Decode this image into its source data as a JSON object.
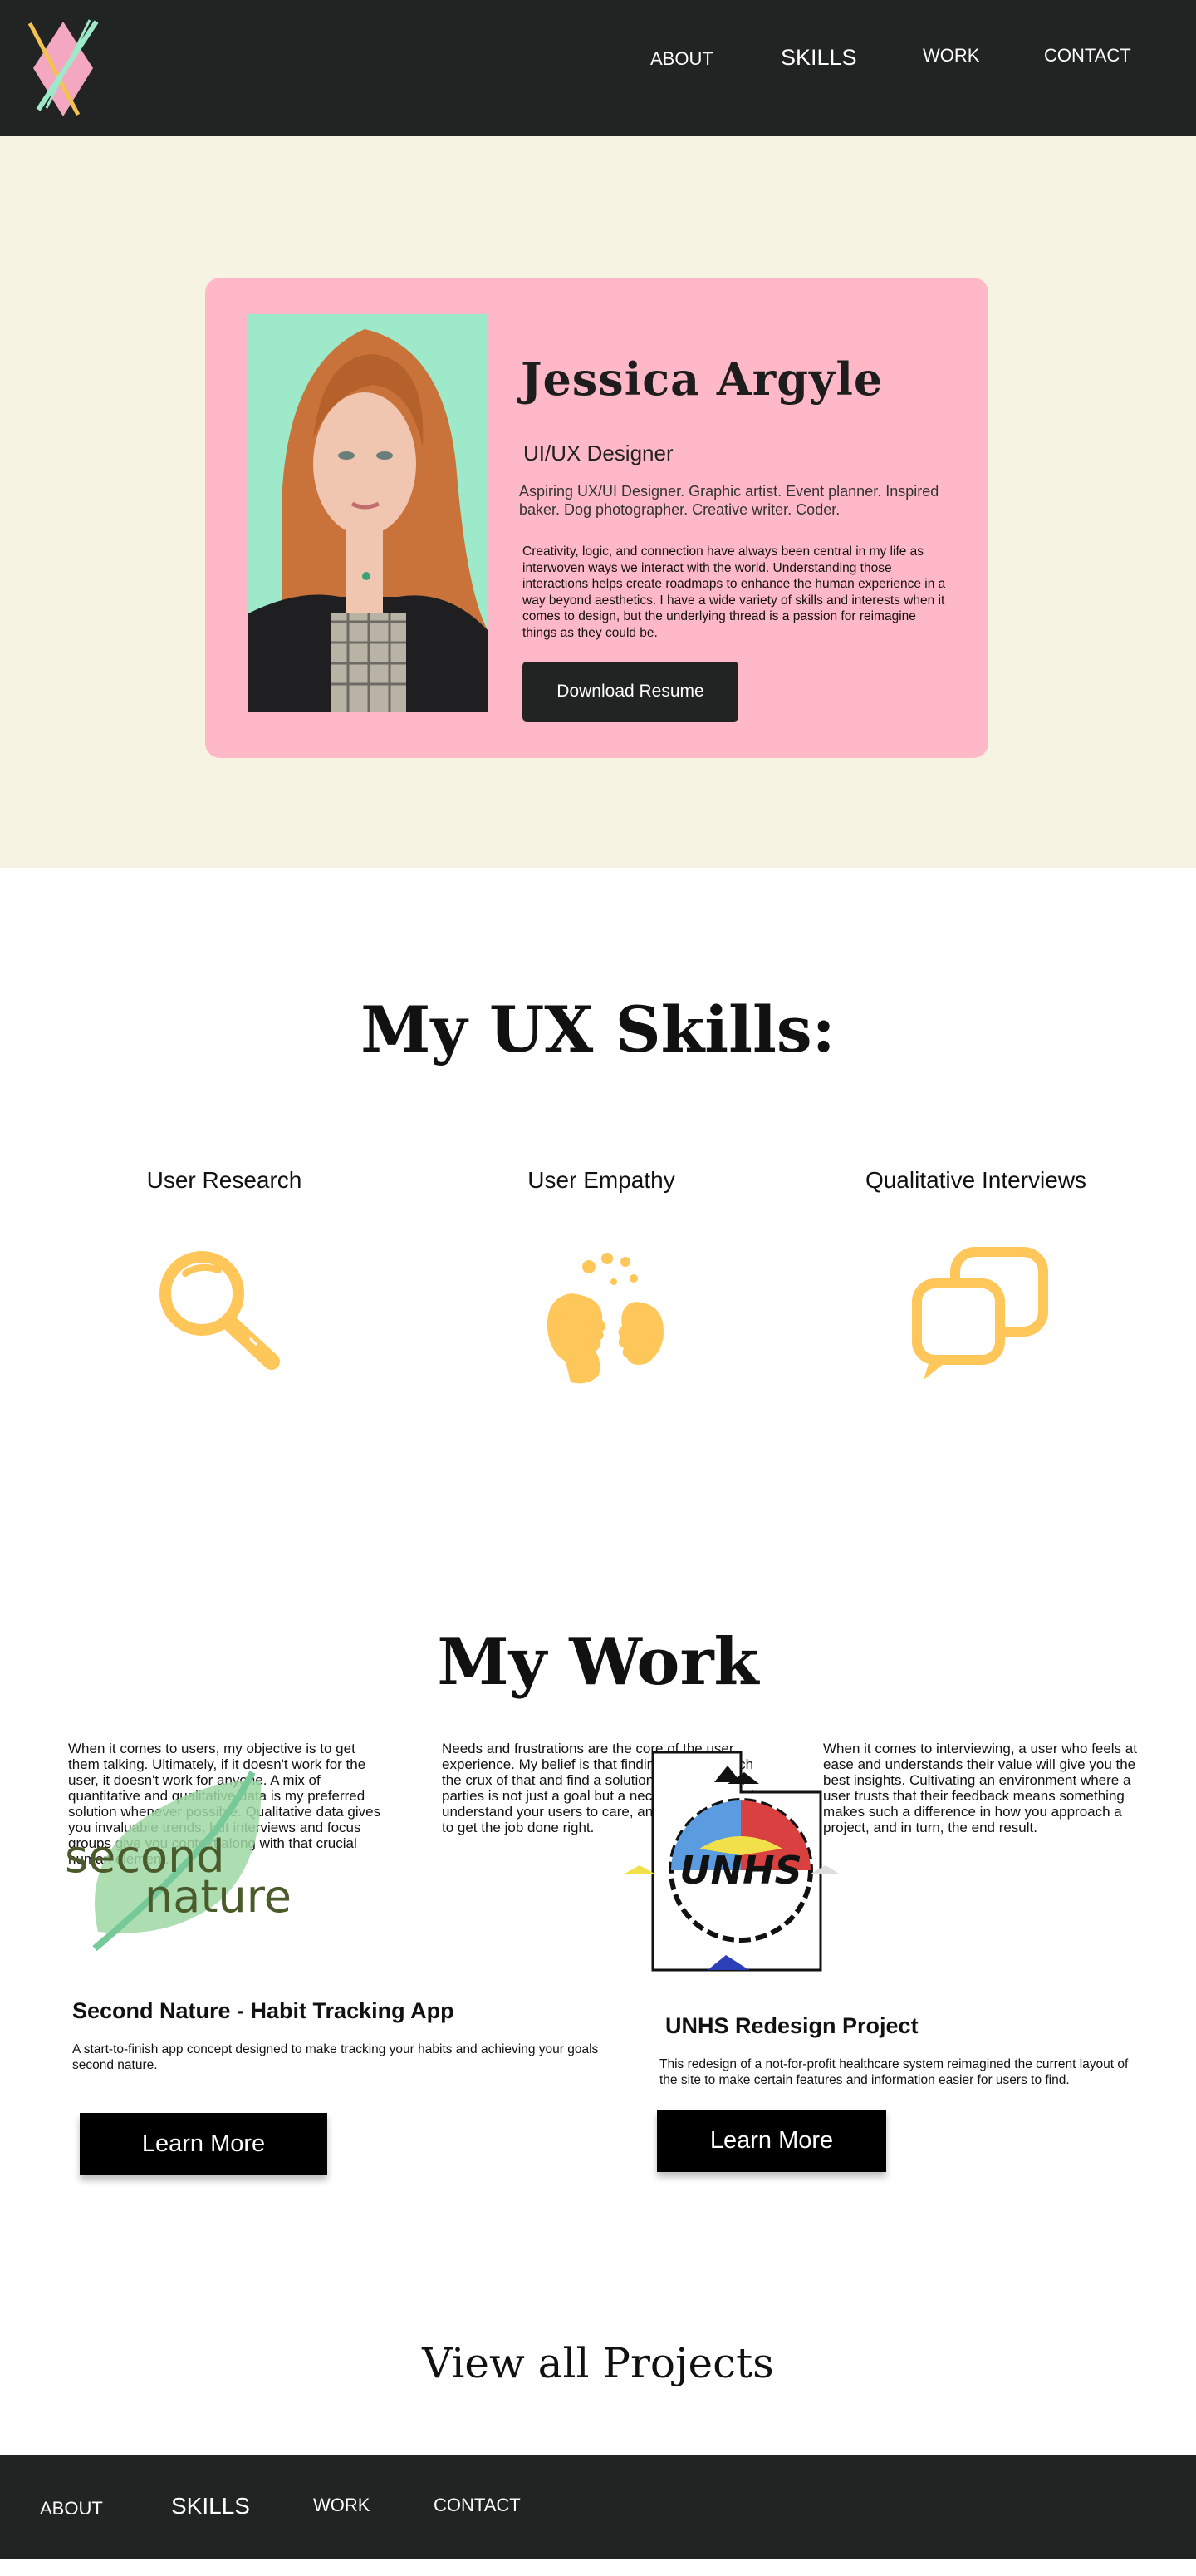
{
  "nav": {
    "about": "ABOUT",
    "skills": "SKILLS",
    "work": "WORK",
    "contact": "CONTACT"
  },
  "hero": {
    "name": "Jessica Argyle",
    "role": "UI/UX Designer",
    "tagline": "Aspiring UX/UI Designer. Graphic artist. Event planner. Inspired baker. Dog photographer. Creative writer. Coder.",
    "bio": "Creativity, logic, and connection have always been central in my life as interwoven ways we interact with the world. Understanding those interactions helps create roadmaps to enhance the human experience in a way beyond aesthetics. I have a wide variety of skills and interests when it comes to design, but the underlying thread is a passion for reimagine things as they could be.",
    "resume_button": "Download Resume"
  },
  "skills": {
    "title": "My UX Skills:",
    "items": [
      {
        "title": "User Research",
        "icon": "magnifier-icon",
        "text": "When it comes to users, my objective is to get them talking. Ultimately, if it doesn't work for the user, it doesn't work for anyone. A mix of quantitative and qualitative data is my preferred solution whenever possible. Qualitative data gives you invaluable trends, but interviews and focus groups give you context along with that crucial human element."
      },
      {
        "title": "User Empathy",
        "icon": "empathy-heads-icon",
        "text": "Needs and frustrations are the core of the user experience. My belief is that finding ways to reach the crux of that and find a solution that serves all parties is not just a goal but a necessity. You need to understand your users to care, and you need to care to get the job done right."
      },
      {
        "title": "Qualitative Interviews",
        "icon": "chat-bubbles-icon",
        "text": "When it comes to interviewing, a user who feels at ease and understands their value will give you the best insights. Cultivating an environment where a user trusts that their feedback means something makes such a difference in how you approach a project, and in turn, the end result."
      }
    ]
  },
  "work": {
    "title": "My Work",
    "projects": [
      {
        "logo_text_1": "second",
        "logo_text_2": "nature",
        "title": "Second Nature - Habit Tracking App",
        "description": "A start-to-finish app concept designed to make tracking your habits and achieving your goals second nature.",
        "button": "Learn More"
      },
      {
        "logo_text": "UNHS",
        "title": "UNHS Redesign Project",
        "description": "This redesign of a not-for-profit healthcare system reimagined the current layout of the site to make certain features and information easier for users to find.",
        "button": "Learn More"
      }
    ],
    "view_all": "View all Projects"
  },
  "footer": {
    "about": "ABOUT",
    "skills": "SKILLS",
    "work": "WORK",
    "contact": "CONTACT"
  },
  "colors": {
    "dark": "#212423",
    "cream": "#f6f3e2",
    "pink": "#ffb8c7",
    "mint": "#9de9c9",
    "icon_yellow": "#ffc75a"
  }
}
